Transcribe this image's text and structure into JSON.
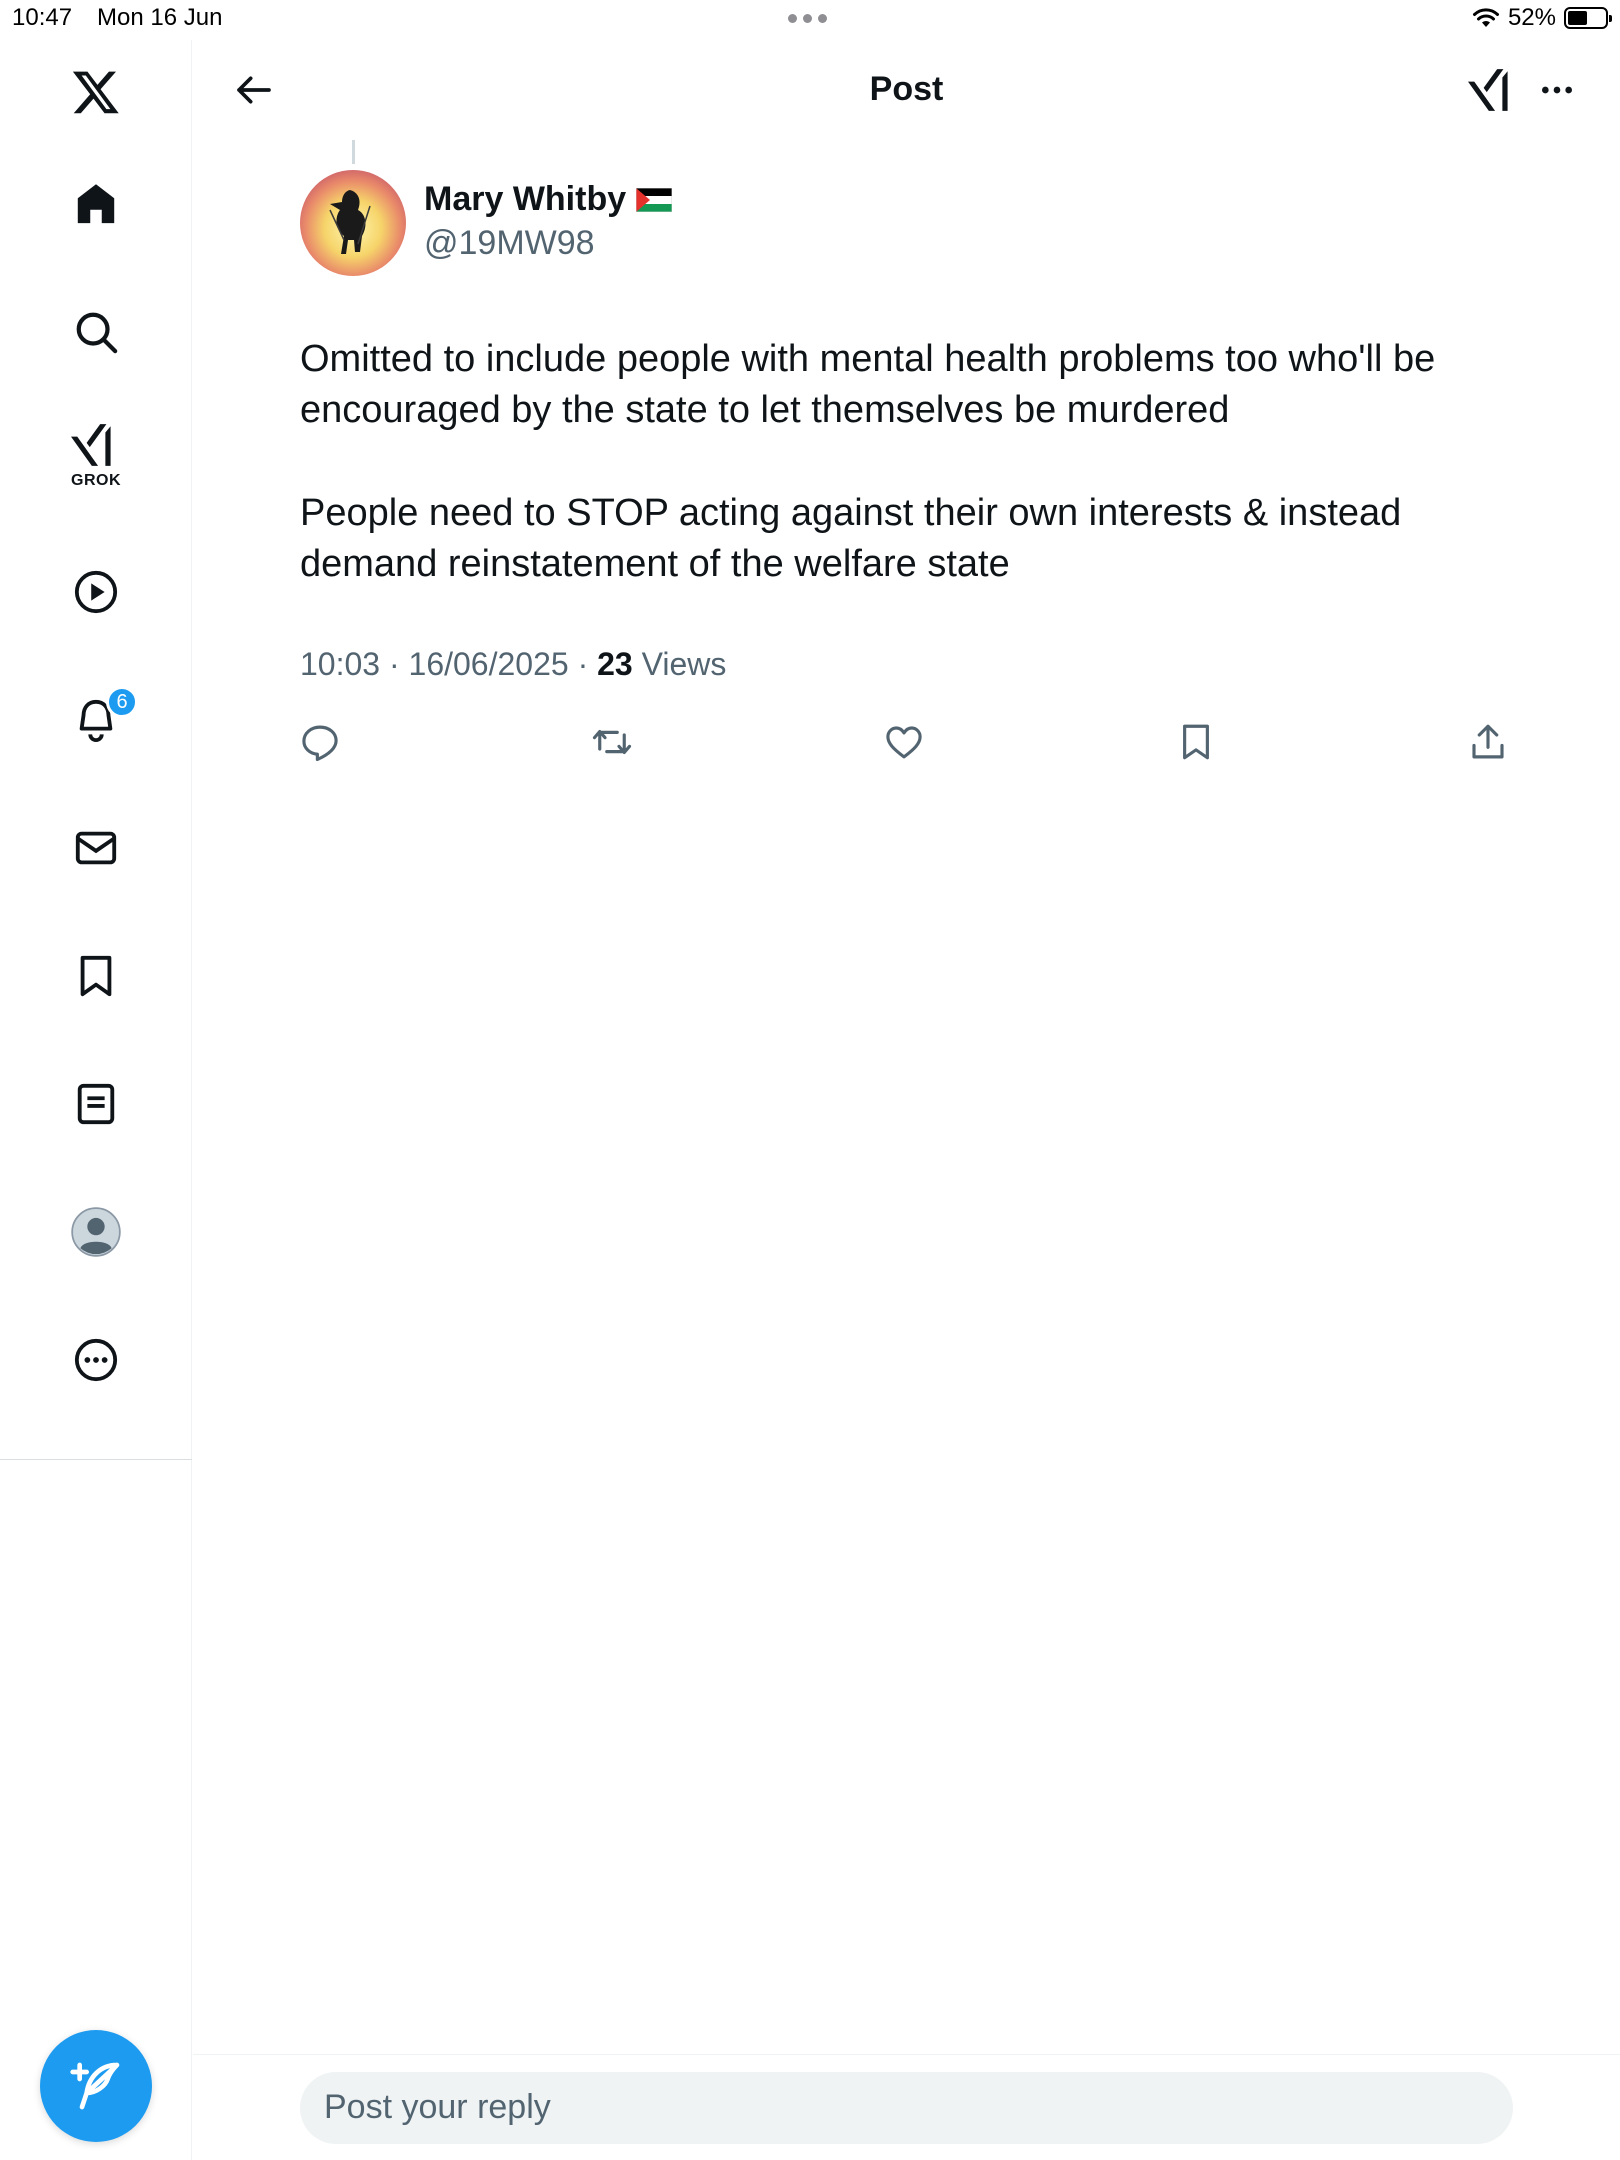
{
  "status_bar": {
    "time": "10:47",
    "date": "Mon 16 Jun",
    "battery": "52%"
  },
  "sidebar": {
    "items": [
      {
        "name": "x-logo-icon"
      },
      {
        "name": "home-icon"
      },
      {
        "name": "search-icon"
      },
      {
        "name": "grok-icon",
        "label": "GROK"
      },
      {
        "name": "video-icon"
      },
      {
        "name": "notifications-icon",
        "badge": "6"
      },
      {
        "name": "messages-icon"
      },
      {
        "name": "bookmarks-icon"
      },
      {
        "name": "lists-icon"
      },
      {
        "name": "profile-icon"
      },
      {
        "name": "more-icon"
      }
    ],
    "compose_icon": "compose-post-icon"
  },
  "header": {
    "title": "Post"
  },
  "post": {
    "author_name": "Mary Whitby",
    "author_handle": "@19MW98",
    "paragraphs": [
      "Omitted to include people with mental health problems too who'll be encouraged by the state to let themselves be murdered",
      "People need to STOP acting against their own interests & instead demand reinstatement of the welfare state"
    ],
    "time": "10:03",
    "date": "16/06/2025",
    "views_count": "23",
    "views_label": "Views",
    "actions": [
      "reply-icon",
      "repost-icon",
      "like-icon",
      "bookmark-icon",
      "share-icon"
    ]
  },
  "reply": {
    "placeholder": "Post your reply"
  },
  "colors": {
    "accent": "#1d9bf0",
    "text": "#0f1419",
    "secondary": "#536471"
  }
}
